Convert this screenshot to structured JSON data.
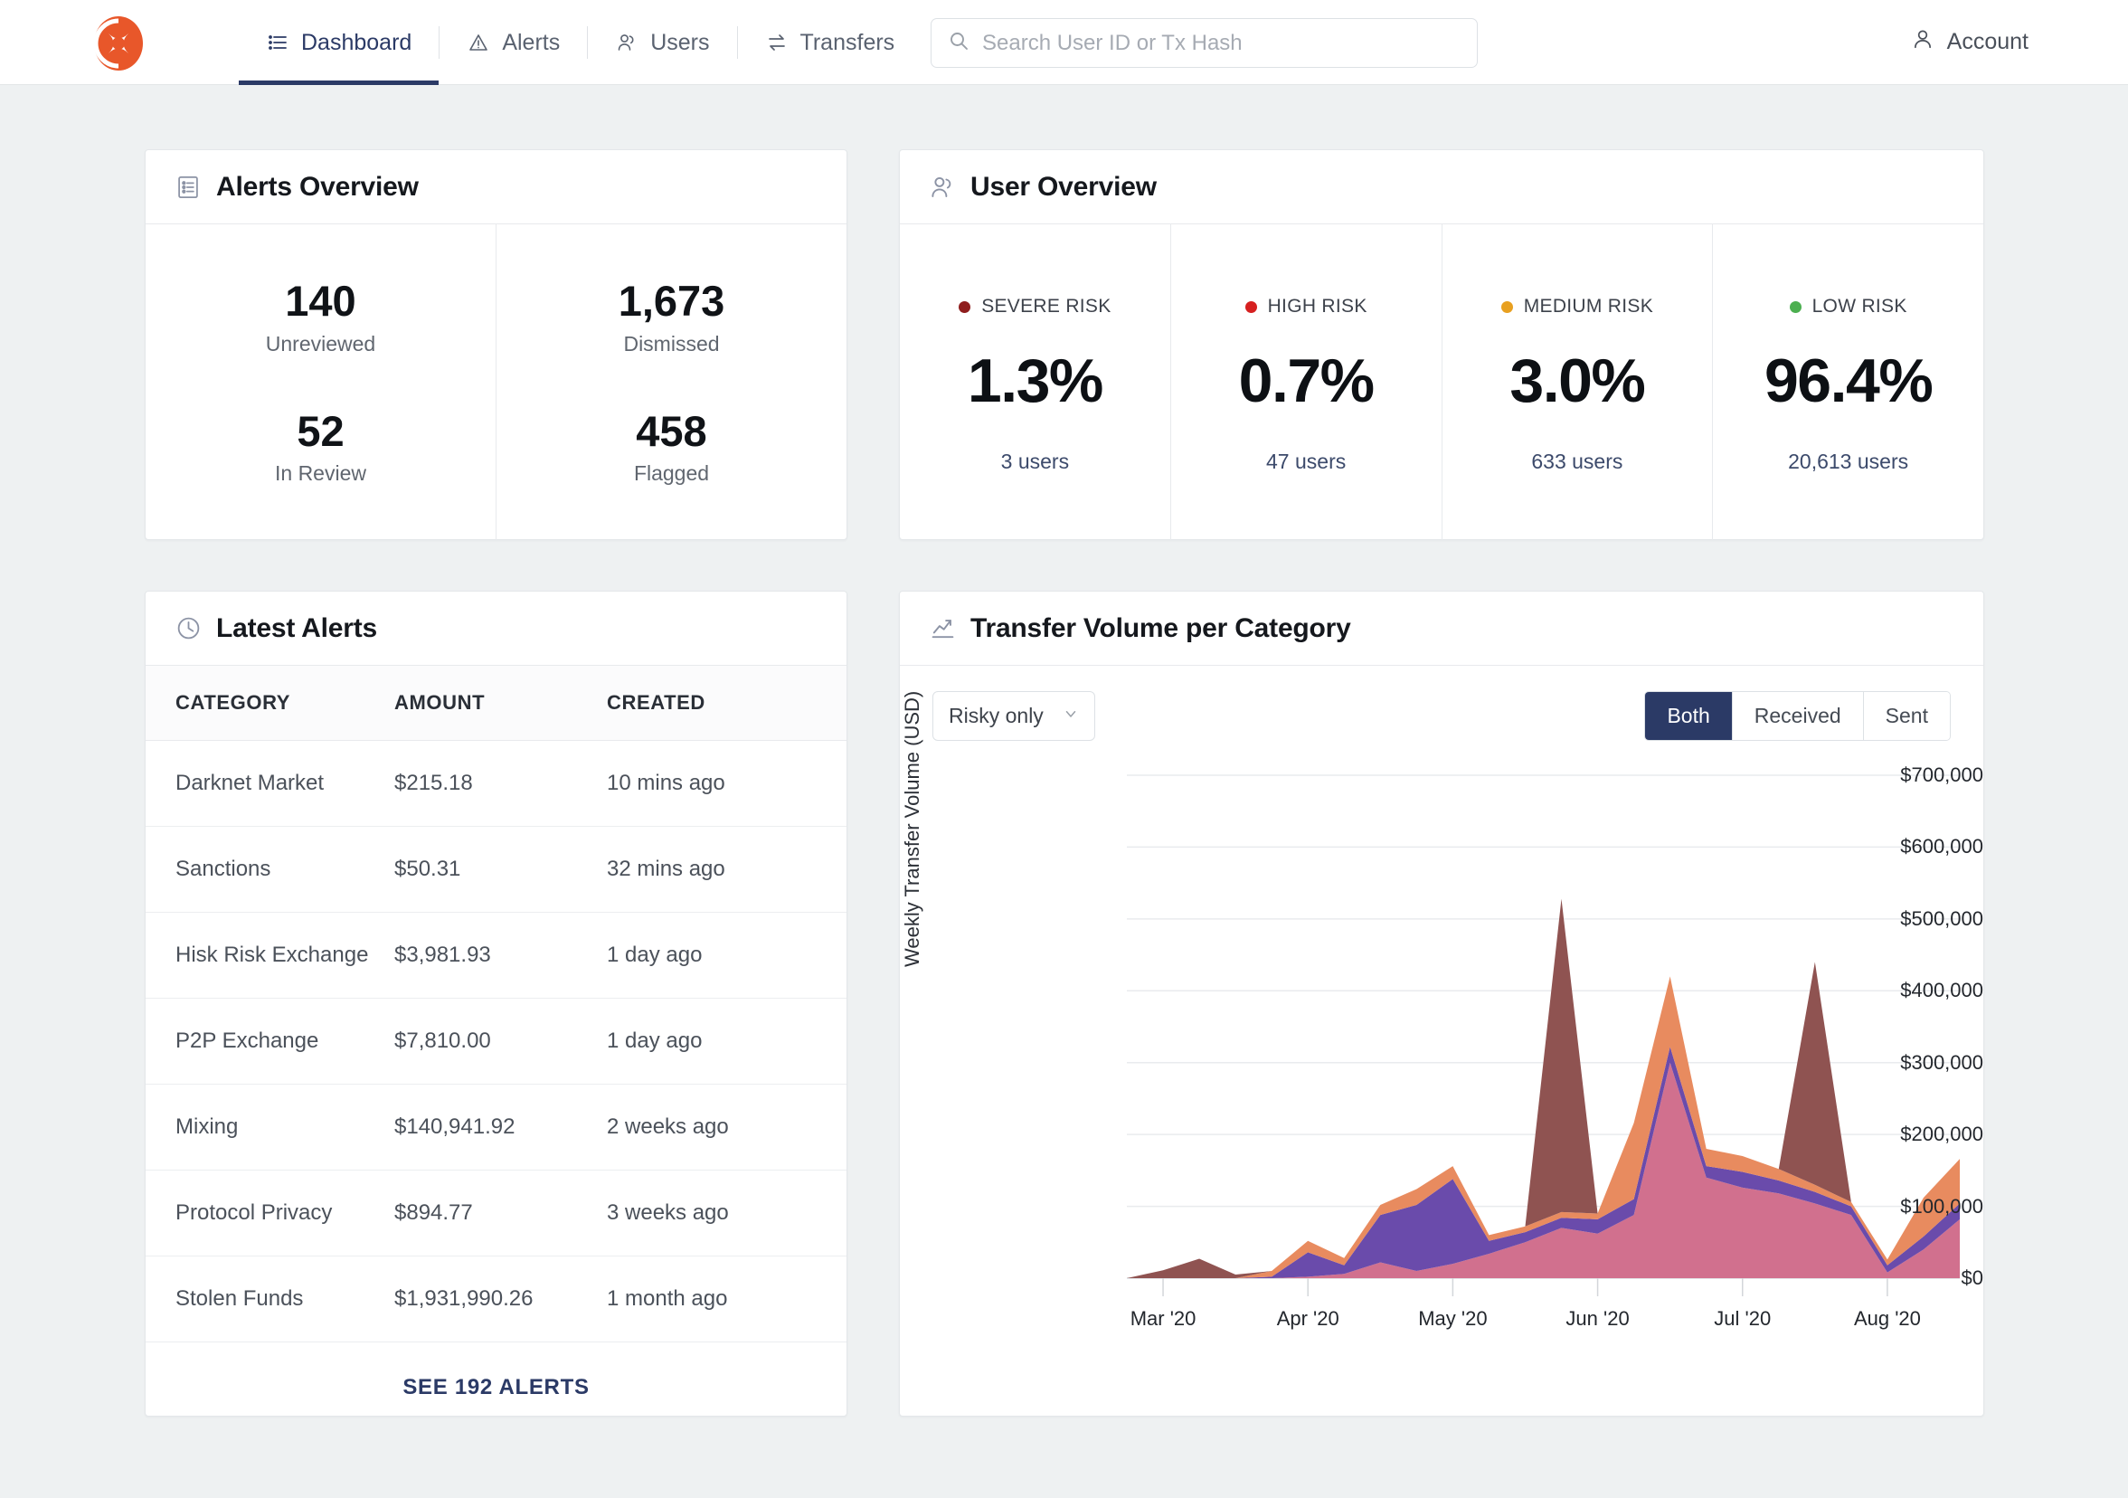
{
  "header": {
    "logo_icon": "brand-logo-icon",
    "nav": [
      {
        "label": "Dashboard",
        "icon": "list-icon",
        "active": true
      },
      {
        "label": "Alerts",
        "icon": "warning-triangle-icon",
        "active": false
      },
      {
        "label": "Users",
        "icon": "users-icon",
        "active": false
      },
      {
        "label": "Transfers",
        "icon": "transfers-arrows-icon",
        "active": false
      }
    ],
    "search": {
      "placeholder": "Search User ID or Tx Hash",
      "value": "",
      "icon": "search-icon"
    },
    "account": {
      "label": "Account",
      "icon": "person-icon"
    }
  },
  "alerts_overview": {
    "title": "Alerts Overview",
    "icon": "list-panel-icon",
    "stats": [
      {
        "value": "140",
        "label": "Unreviewed"
      },
      {
        "value": "1,673",
        "label": "Dismissed"
      },
      {
        "value": "52",
        "label": "In Review"
      },
      {
        "value": "458",
        "label": "Flagged"
      }
    ]
  },
  "user_overview": {
    "title": "User Overview",
    "icon": "users-icon",
    "segments": [
      {
        "label": "SEVERE RISK",
        "percent": "1.3%",
        "users": "3 users",
        "color": "#8f1d1d"
      },
      {
        "label": "HIGH RISK",
        "percent": "0.7%",
        "users": "47 users",
        "color": "#d62020"
      },
      {
        "label": "MEDIUM RISK",
        "percent": "3.0%",
        "users": "633 users",
        "color": "#e8a020"
      },
      {
        "label": "LOW RISK",
        "percent": "96.4%",
        "users": "20,613 users",
        "color": "#4caf50"
      }
    ]
  },
  "latest_alerts": {
    "title": "Latest Alerts",
    "icon": "clock-icon",
    "columns": [
      "CATEGORY",
      "AMOUNT",
      "CREATED"
    ],
    "rows": [
      {
        "category": "Darknet Market",
        "amount": "$215.18",
        "created": "10 mins ago"
      },
      {
        "category": "Sanctions",
        "amount": "$50.31",
        "created": "32 mins ago"
      },
      {
        "category": "Hisk Risk Exchange",
        "amount": "$3,981.93",
        "created": "1 day ago"
      },
      {
        "category": "P2P Exchange",
        "amount": "$7,810.00",
        "created": "1 day ago"
      },
      {
        "category": "Mixing",
        "amount": "$140,941.92",
        "created": "2 weeks ago"
      },
      {
        "category": "Protocol Privacy",
        "amount": "$894.77",
        "created": "3 weeks ago"
      },
      {
        "category": "Stolen Funds",
        "amount": "$1,931,990.26",
        "created": "1 month ago"
      }
    ],
    "see_all_label": "SEE 192 ALERTS"
  },
  "chart_card": {
    "title": "Transfer Volume per Category",
    "icon": "line-chart-icon",
    "filter_select": {
      "value": "Risky only",
      "icon": "chevron-down-icon"
    },
    "direction_toggle": {
      "options": [
        "Both",
        "Received",
        "Sent"
      ],
      "selected": "Both"
    }
  },
  "chart_data": {
    "type": "area",
    "stacked": true,
    "title": "Transfer Volume per Category",
    "xlabel": "",
    "ylabel": "Weekly Transfer Volume (USD)",
    "ylim": [
      0,
      700000
    ],
    "yticks": [
      0,
      100000,
      200000,
      300000,
      400000,
      500000,
      600000,
      700000
    ],
    "ytick_labels": [
      "$0",
      "$100,000",
      "$200,000",
      "$300,000",
      "$400,000",
      "$500,000",
      "$600,000",
      "$700,000"
    ],
    "xtick_labels": [
      "Mar '20",
      "Apr '20",
      "May '20",
      "Jun '20",
      "Jul '20",
      "Aug '20"
    ],
    "grid": true,
    "legend": "none",
    "x": [
      0,
      1,
      2,
      3,
      4,
      5,
      6,
      7,
      8,
      9,
      10,
      11,
      12,
      13,
      14,
      15,
      16,
      17,
      18,
      19,
      20,
      21,
      22,
      23
    ],
    "series": [
      {
        "name": "pink",
        "color": "#d1708e",
        "values": [
          0,
          0,
          0,
          0,
          0,
          2000,
          6000,
          22000,
          10000,
          20000,
          34000,
          50000,
          70000,
          62000,
          88000,
          300000,
          140000,
          126000,
          118000,
          104000,
          88000,
          8000,
          40000,
          82000
        ]
      },
      {
        "name": "purple",
        "color": "#6a4bab",
        "values": [
          0,
          0,
          0,
          0,
          2000,
          34000,
          12000,
          66000,
          92000,
          118000,
          18000,
          14000,
          14000,
          20000,
          22000,
          22000,
          16000,
          22000,
          18000,
          16000,
          12000,
          10000,
          18000,
          22000
        ]
      },
      {
        "name": "orange",
        "color": "#e88b5f",
        "values": [
          0,
          0,
          0,
          0,
          8000,
          16000,
          10000,
          14000,
          22000,
          18000,
          8000,
          8000,
          8000,
          8000,
          106000,
          98000,
          24000,
          22000,
          16000,
          10000,
          6000,
          8000,
          54000,
          62000
        ]
      },
      {
        "name": "brown",
        "color": "#8f5351",
        "values": [
          0,
          11000,
          27000,
          5000,
          0,
          0,
          0,
          0,
          0,
          0,
          0,
          0,
          436000,
          0,
          0,
          0,
          0,
          0,
          0,
          310000,
          0,
          0,
          0,
          0
        ]
      }
    ]
  }
}
